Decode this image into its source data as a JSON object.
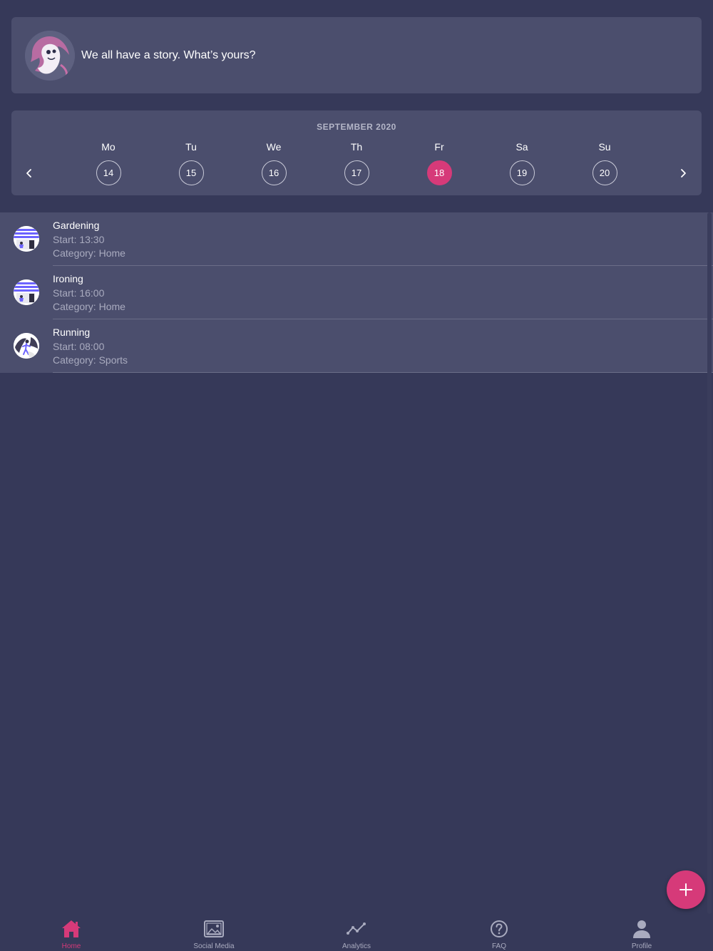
{
  "story": {
    "prompt": "We all have a story. What’s yours?",
    "avatar_icon": "ghost-avatar-icon"
  },
  "calendar": {
    "month": "SEPTEMBER 2020",
    "prev_icon": "chevron-left-icon",
    "next_icon": "chevron-right-icon",
    "days": [
      {
        "name": "Mo",
        "number": "14",
        "selected": false
      },
      {
        "name": "Tu",
        "number": "15",
        "selected": false
      },
      {
        "name": "We",
        "number": "16",
        "selected": false
      },
      {
        "name": "Th",
        "number": "17",
        "selected": false
      },
      {
        "name": "Fr",
        "number": "18",
        "selected": true
      },
      {
        "name": "Sa",
        "number": "19",
        "selected": false
      },
      {
        "name": "Su",
        "number": "20",
        "selected": false
      }
    ]
  },
  "activities": [
    {
      "name": "Gardening",
      "start": "Start: 13:30",
      "category": "Category: Home",
      "icon": "home-scene-icon"
    },
    {
      "name": "Ironing",
      "start": "Start: 16:00",
      "category": "Category: Home",
      "icon": "home-scene-icon"
    },
    {
      "name": "Running",
      "start": "Start: 08:00",
      "category": "Category: Sports",
      "icon": "runner-icon"
    }
  ],
  "fab": {
    "icon": "plus-icon"
  },
  "bottom_nav": {
    "items": [
      {
        "label": "Home",
        "icon": "home-icon",
        "active": true
      },
      {
        "label": "Social Media",
        "icon": "image-icon",
        "active": false
      },
      {
        "label": "Analytics",
        "icon": "analytics-icon",
        "active": false
      },
      {
        "label": "FAQ",
        "icon": "question-icon",
        "active": false
      },
      {
        "label": "Profile",
        "icon": "person-icon",
        "active": false
      }
    ]
  },
  "colors": {
    "background": "#363959",
    "card": "#4b4e6d",
    "accent": "#d63a79",
    "muted_text": "#a9abbf"
  }
}
